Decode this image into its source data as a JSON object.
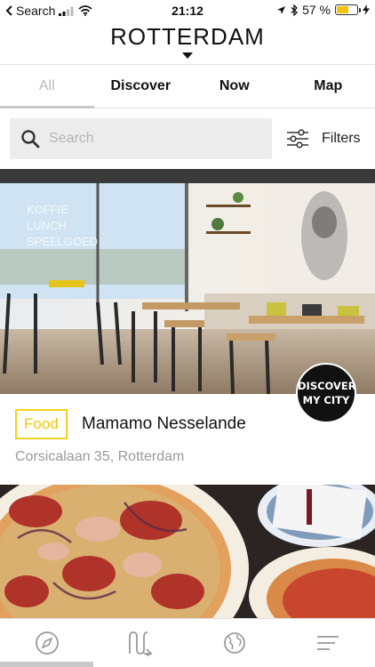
{
  "status_bar": {
    "back_label": "Search",
    "time": "21:12",
    "battery_text": "57 %",
    "battery_level": 0.57
  },
  "header": {
    "title": "ROTTERDAM"
  },
  "tabs": [
    {
      "label": "All",
      "active": true
    },
    {
      "label": "Discover",
      "active": false
    },
    {
      "label": "Now",
      "active": false
    },
    {
      "label": "Map",
      "active": false
    }
  ],
  "search": {
    "placeholder": "Search",
    "filters_label": "Filters"
  },
  "cards": [
    {
      "category": "Food",
      "name": "Mamamo Nesselande",
      "address": "Corsicalaan 35, Rotterdam",
      "badge_line1": "DISCOVER",
      "badge_line2": "MY CITY"
    }
  ],
  "colors": {
    "accent_yellow": "#f2d31b",
    "muted_text": "#9a9a9a",
    "search_bg": "#ececec"
  },
  "bottom_bar": {
    "icons": [
      "compass-icon",
      "routes-icon",
      "globe-icon",
      "menu-icon"
    ]
  }
}
